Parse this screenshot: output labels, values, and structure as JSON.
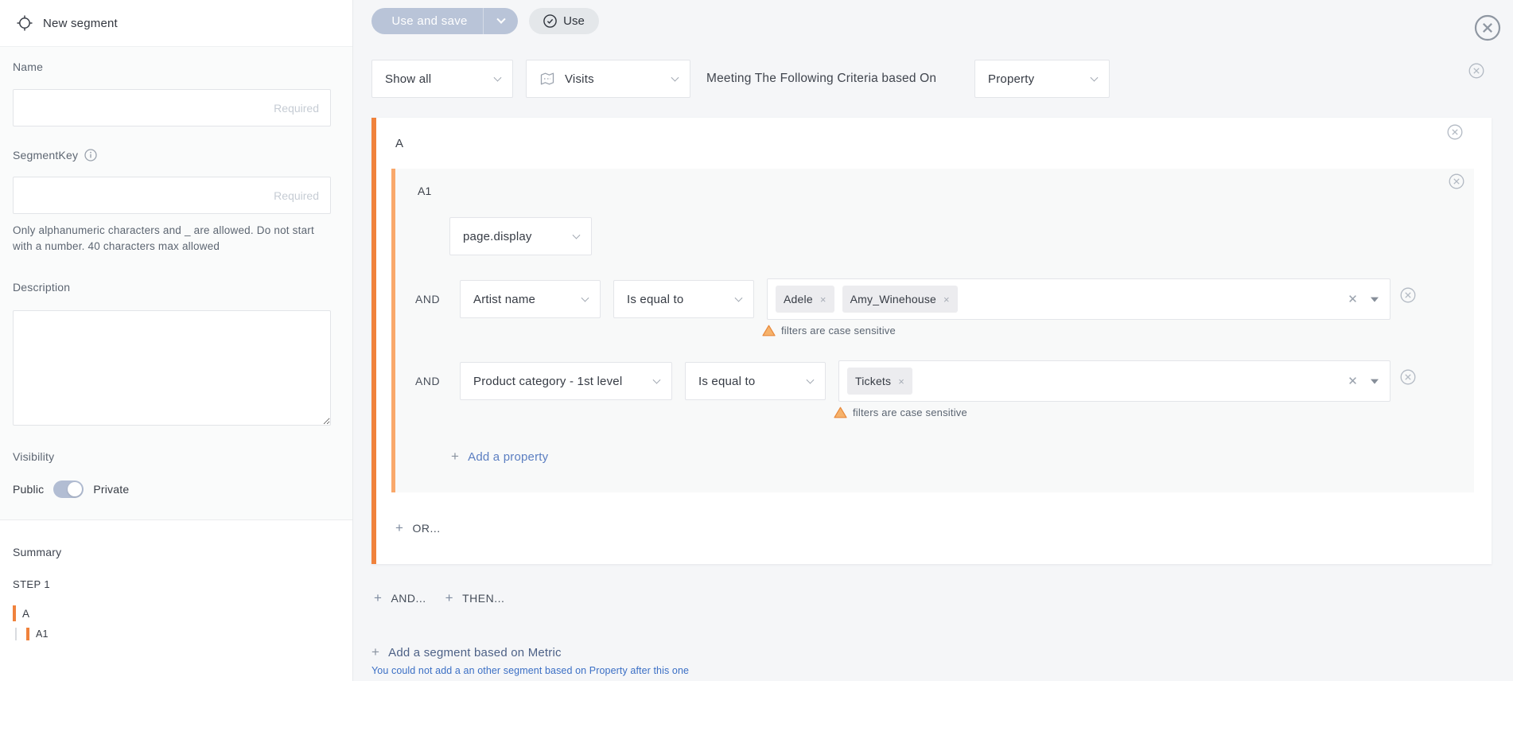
{
  "header": {
    "title": "New segment"
  },
  "toolbar": {
    "use_and_save_label": "Use and save",
    "use_label": "Use"
  },
  "sidebar": {
    "name_label": "Name",
    "name_value": "",
    "name_placeholder": "Required",
    "segmentkey_label": "SegmentKey",
    "segmentkey_value": "",
    "segmentkey_placeholder": "Required",
    "segmentkey_help": "Only alphanumeric characters and _ are allowed. Do not start with a number. 40 characters max allowed",
    "description_label": "Description",
    "description_value": "",
    "visibility_label": "Visibility",
    "visibility_public": "Public",
    "visibility_private": "Private",
    "visibility_state": "Private",
    "summary": {
      "title": "Summary",
      "step": "STEP 1",
      "group": "A",
      "subgroup": "A1"
    }
  },
  "criteria_bar": {
    "scope_select": "Show all",
    "metric_select": "Visits",
    "statement": "Meeting The Following Criteria based On",
    "based_on_select": "Property"
  },
  "segment": {
    "group_label": "A",
    "subgroup_label": "A1",
    "property_select": "page.display",
    "conditions": [
      {
        "operator": "AND",
        "property": "Artist name",
        "comparator": "Is equal to",
        "values": [
          "Adele",
          "Amy_Winehouse"
        ],
        "warning": "filters are case sensitive"
      },
      {
        "operator": "AND",
        "property": "Product category - 1st level",
        "comparator": "Is equal to",
        "values": [
          "Tickets"
        ],
        "warning": "filters are case sensitive"
      }
    ],
    "add_property_label": "Add a property",
    "or_label": "OR...",
    "and_label": "AND...",
    "then_label": "THEN...",
    "add_metric_label": "Add a segment based on Metric",
    "add_metric_note": "You could not add a an other segment based on Property after this one"
  },
  "colors": {
    "accent_orange": "#f0823c",
    "accent_orange_light": "#f9a86b",
    "link_blue": "#5b7ec1",
    "note_blue": "#3b6fc5",
    "warning_orange": "#e8883a",
    "toggle_fill": "#b2bdd3",
    "primary_button": "#b9c4d8"
  }
}
